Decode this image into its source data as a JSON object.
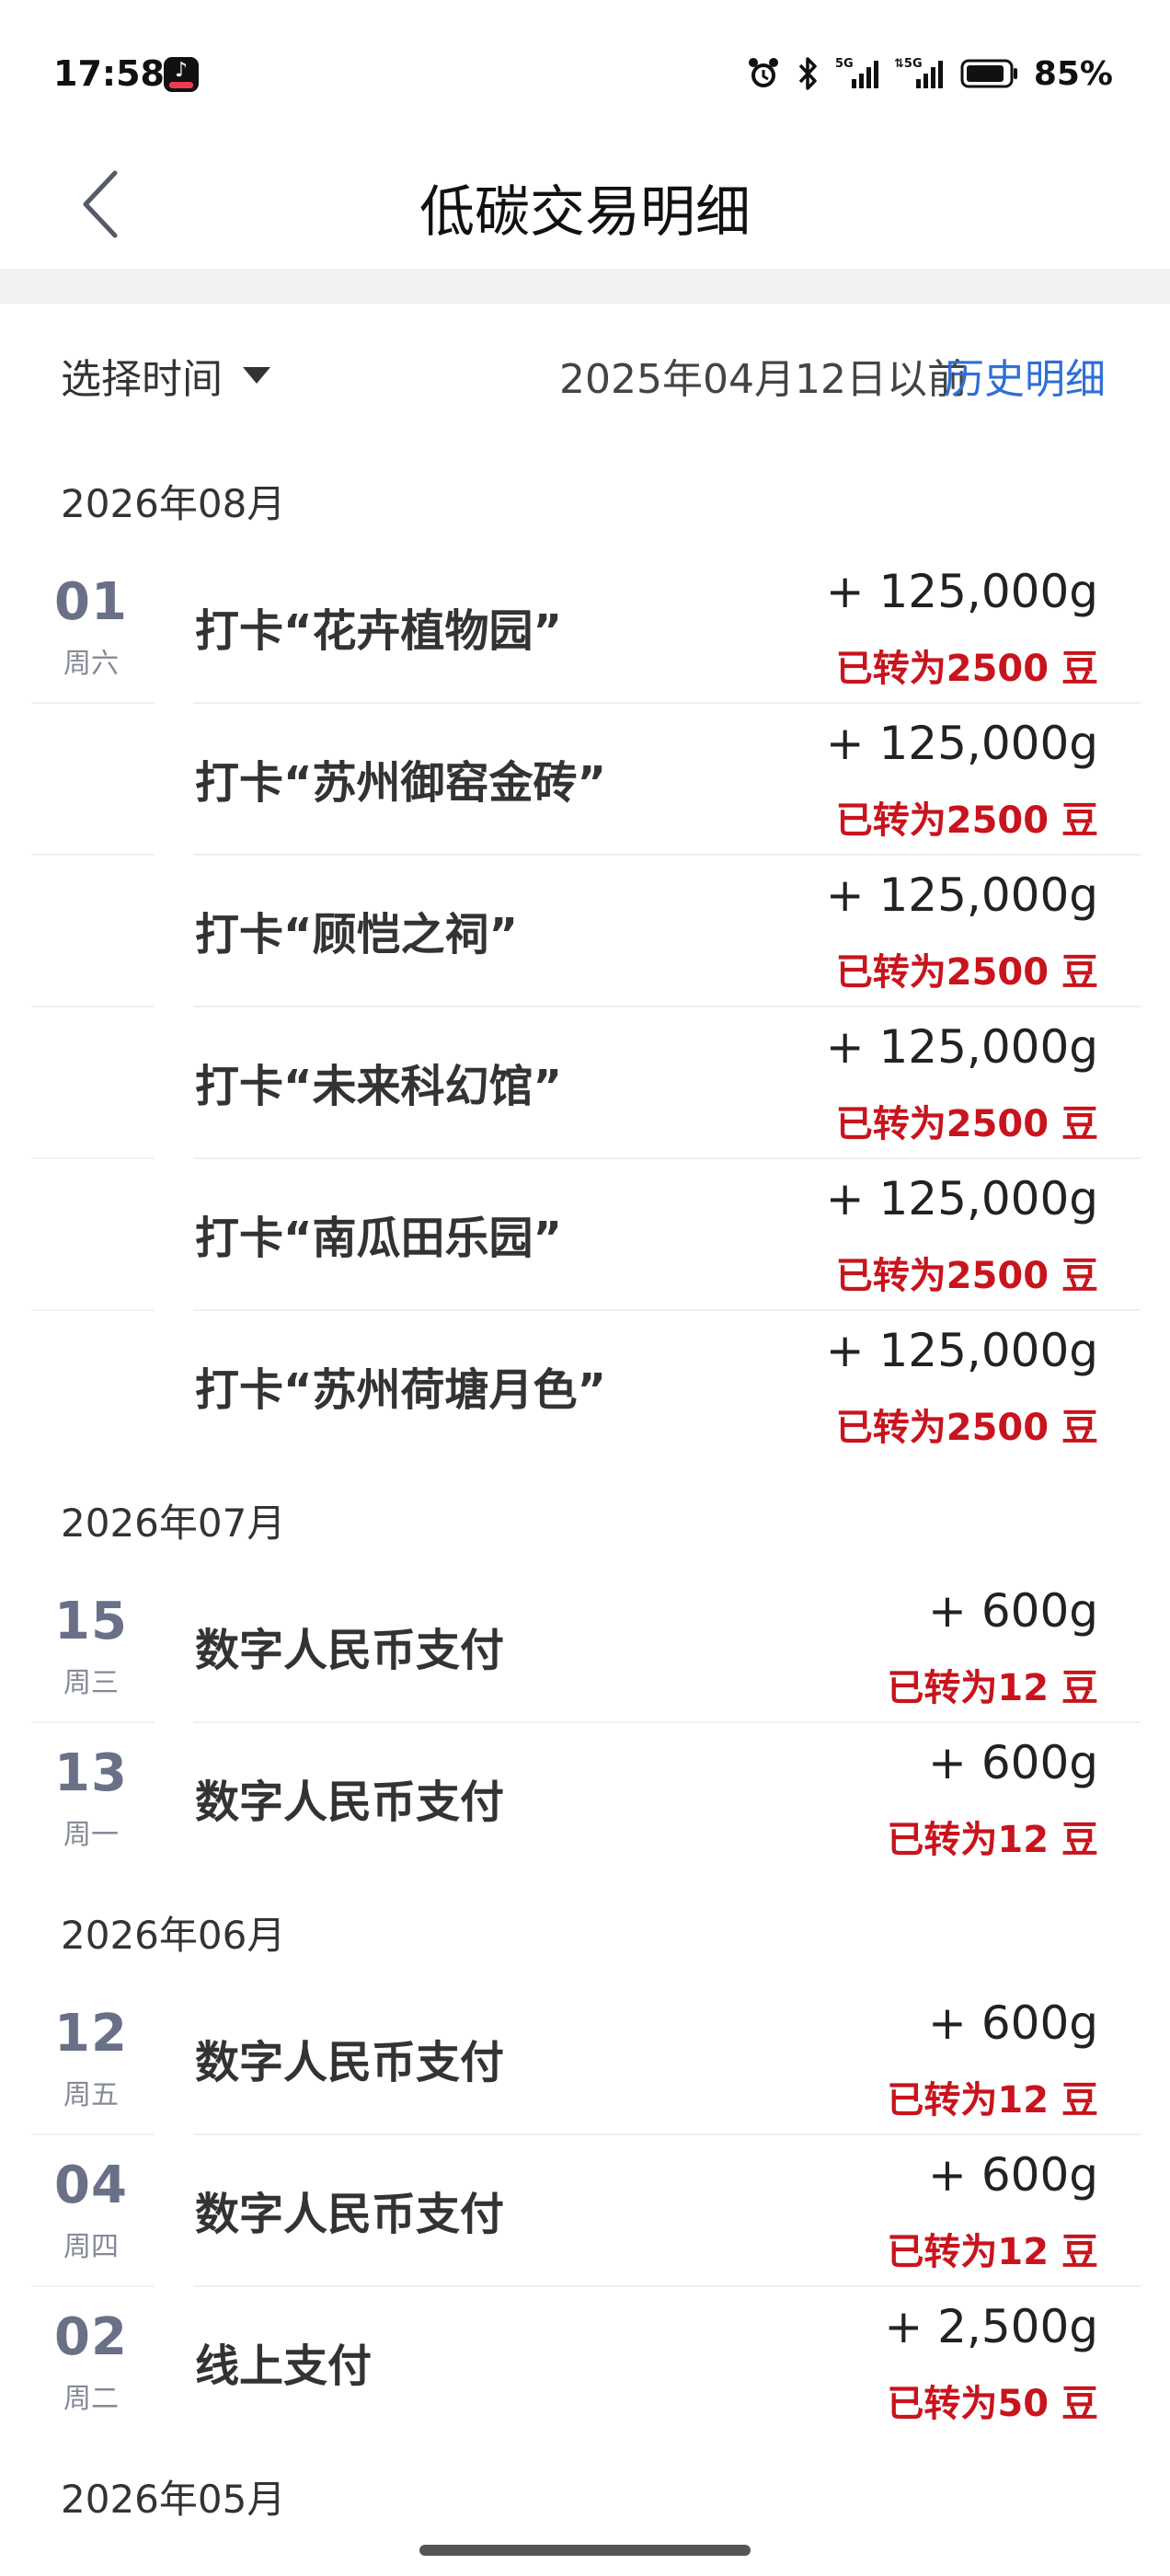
{
  "status": {
    "time": "17:58",
    "battery": "85%"
  },
  "nav": {
    "title": "低碳交易明细"
  },
  "filter": {
    "select_label": "选择时间",
    "before_date": "2025年04月12日以前",
    "history_link": "历史明细"
  },
  "groups": [
    {
      "month": "2026年08月",
      "rows": [
        {
          "day": "01",
          "weekday": "周六",
          "title": "打卡“花卉植物园”",
          "amount": "+ 125,000g",
          "beans": "已转为2500 豆"
        },
        {
          "day": "",
          "weekday": "",
          "title": "打卡“苏州御窑金砖”",
          "amount": "+ 125,000g",
          "beans": "已转为2500 豆"
        },
        {
          "day": "",
          "weekday": "",
          "title": "打卡“顾恺之祠”",
          "amount": "+ 125,000g",
          "beans": "已转为2500 豆"
        },
        {
          "day": "",
          "weekday": "",
          "title": "打卡“未来科幻馆”",
          "amount": "+ 125,000g",
          "beans": "已转为2500 豆"
        },
        {
          "day": "",
          "weekday": "",
          "title": "打卡“南瓜田乐园”",
          "amount": "+ 125,000g",
          "beans": "已转为2500 豆"
        },
        {
          "day": "",
          "weekday": "",
          "title": "打卡“苏州荷塘月色”",
          "amount": "+ 125,000g",
          "beans": "已转为2500 豆"
        }
      ]
    },
    {
      "month": "2026年07月",
      "rows": [
        {
          "day": "15",
          "weekday": "周三",
          "title": "数字人民币支付",
          "amount": "+ 600g",
          "beans": "已转为12 豆"
        },
        {
          "day": "13",
          "weekday": "周一",
          "title": "数字人民币支付",
          "amount": "+ 600g",
          "beans": "已转为12 豆"
        }
      ]
    },
    {
      "month": "2026年06月",
      "rows": [
        {
          "day": "12",
          "weekday": "周五",
          "title": "数字人民币支付",
          "amount": "+ 600g",
          "beans": "已转为12 豆"
        },
        {
          "day": "04",
          "weekday": "周四",
          "title": "数字人民币支付",
          "amount": "+ 600g",
          "beans": "已转为12 豆"
        },
        {
          "day": "02",
          "weekday": "周二",
          "title": "线上支付",
          "amount": "+ 2,500g",
          "beans": "已转为50 豆"
        }
      ]
    },
    {
      "month": "2026年05月",
      "rows": []
    }
  ],
  "colors": {
    "accent_link": "#2f6fd6",
    "beans_red": "#c8141d",
    "day_num": "#697088"
  },
  "icons": [
    "tiktok-icon",
    "alarm-icon",
    "bluetooth-icon",
    "signal-5g-icon",
    "battery-icon",
    "back-chevron-icon",
    "dropdown-caret-icon"
  ]
}
